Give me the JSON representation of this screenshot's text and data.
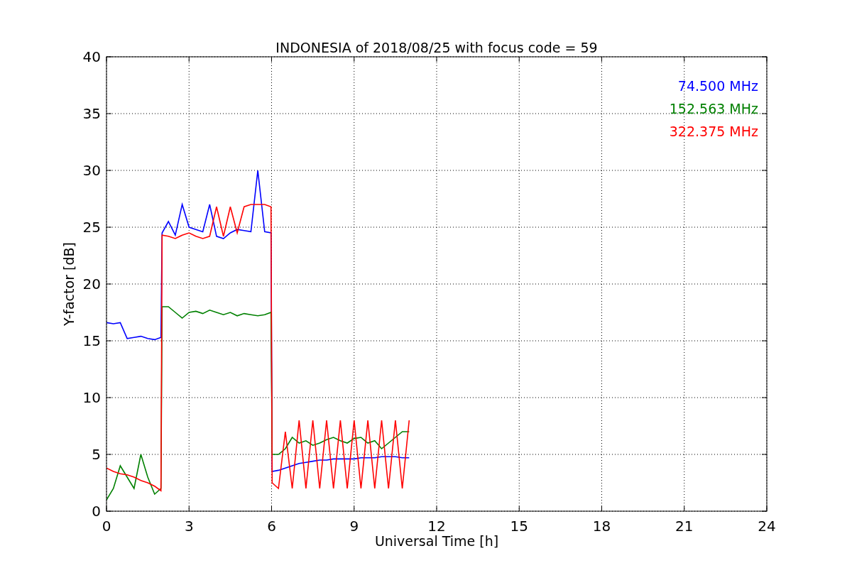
{
  "chart_data": {
    "type": "line",
    "title": "INDONESIA of 2018/08/25 with focus code = 59",
    "xlabel": "Universal Time [h]",
    "ylabel": "Y-factor [dB]",
    "x": [
      0,
      0.25,
      0.5,
      0.75,
      1,
      1.25,
      1.5,
      1.75,
      1.98,
      2.02,
      2.25,
      2.5,
      2.75,
      3,
      3.25,
      3.5,
      3.75,
      4,
      4.25,
      4.5,
      4.75,
      5,
      5.25,
      5.5,
      5.75,
      5.98,
      6.02,
      6.25,
      6.5,
      6.75,
      7,
      7.25,
      7.5,
      7.75,
      8,
      8.25,
      8.5,
      8.75,
      9,
      9.25,
      9.5,
      9.75,
      10,
      10.25,
      10.5,
      10.75,
      11
    ],
    "series": [
      {
        "name": "74.500 MHz",
        "color": "#0000ff",
        "values": [
          16.6,
          16.5,
          16.6,
          15.2,
          15.3,
          15.4,
          15.2,
          15.1,
          15.3,
          24.5,
          25.5,
          24.3,
          27,
          25,
          24.8,
          24.6,
          27,
          24.2,
          24,
          24.5,
          24.8,
          24.7,
          24.6,
          30,
          24.6,
          24.5,
          3.5,
          3.6,
          3.8,
          4.0,
          4.2,
          4.3,
          4.4,
          4.5,
          4.5,
          4.6,
          4.6,
          4.6,
          4.6,
          4.7,
          4.7,
          4.7,
          4.8,
          4.8,
          4.8,
          4.7,
          4.7
        ]
      },
      {
        "name": "152.563 MHz",
        "color": "#008000",
        "values": [
          1,
          2,
          4,
          3,
          2,
          5,
          3,
          1.5,
          2,
          18,
          18,
          17.5,
          17,
          17.5,
          17.6,
          17.4,
          17.7,
          17.5,
          17.3,
          17.5,
          17.2,
          17.4,
          17.3,
          17.2,
          17.3,
          17.5,
          5,
          5,
          5.5,
          6.5,
          6,
          6.2,
          5.8,
          6,
          6.3,
          6.5,
          6.2,
          6,
          6.4,
          6.5,
          6,
          6.2,
          5.5,
          6,
          6.5,
          7,
          7
        ]
      },
      {
        "name": "322.375 MHz",
        "color": "#ff0000",
        "values": [
          3.8,
          3.5,
          3.3,
          3.2,
          3,
          2.7,
          2.5,
          2.2,
          1.8,
          24.3,
          24.2,
          24,
          24.3,
          24.5,
          24.2,
          24,
          24.2,
          26.8,
          24.2,
          26.8,
          24.5,
          26.8,
          27,
          27,
          27,
          26.8,
          2.5,
          2,
          7,
          2,
          8,
          2,
          8,
          2,
          8,
          2,
          8,
          2,
          8,
          2,
          8,
          2,
          8,
          2,
          8,
          2,
          8
        ]
      }
    ],
    "xlim": [
      0,
      24
    ],
    "ylim": [
      0,
      40
    ],
    "xticks": [
      0,
      3,
      6,
      9,
      12,
      15,
      18,
      21,
      24
    ],
    "yticks": [
      0,
      5,
      10,
      15,
      20,
      25,
      30,
      35,
      40
    ],
    "grid": true
  }
}
